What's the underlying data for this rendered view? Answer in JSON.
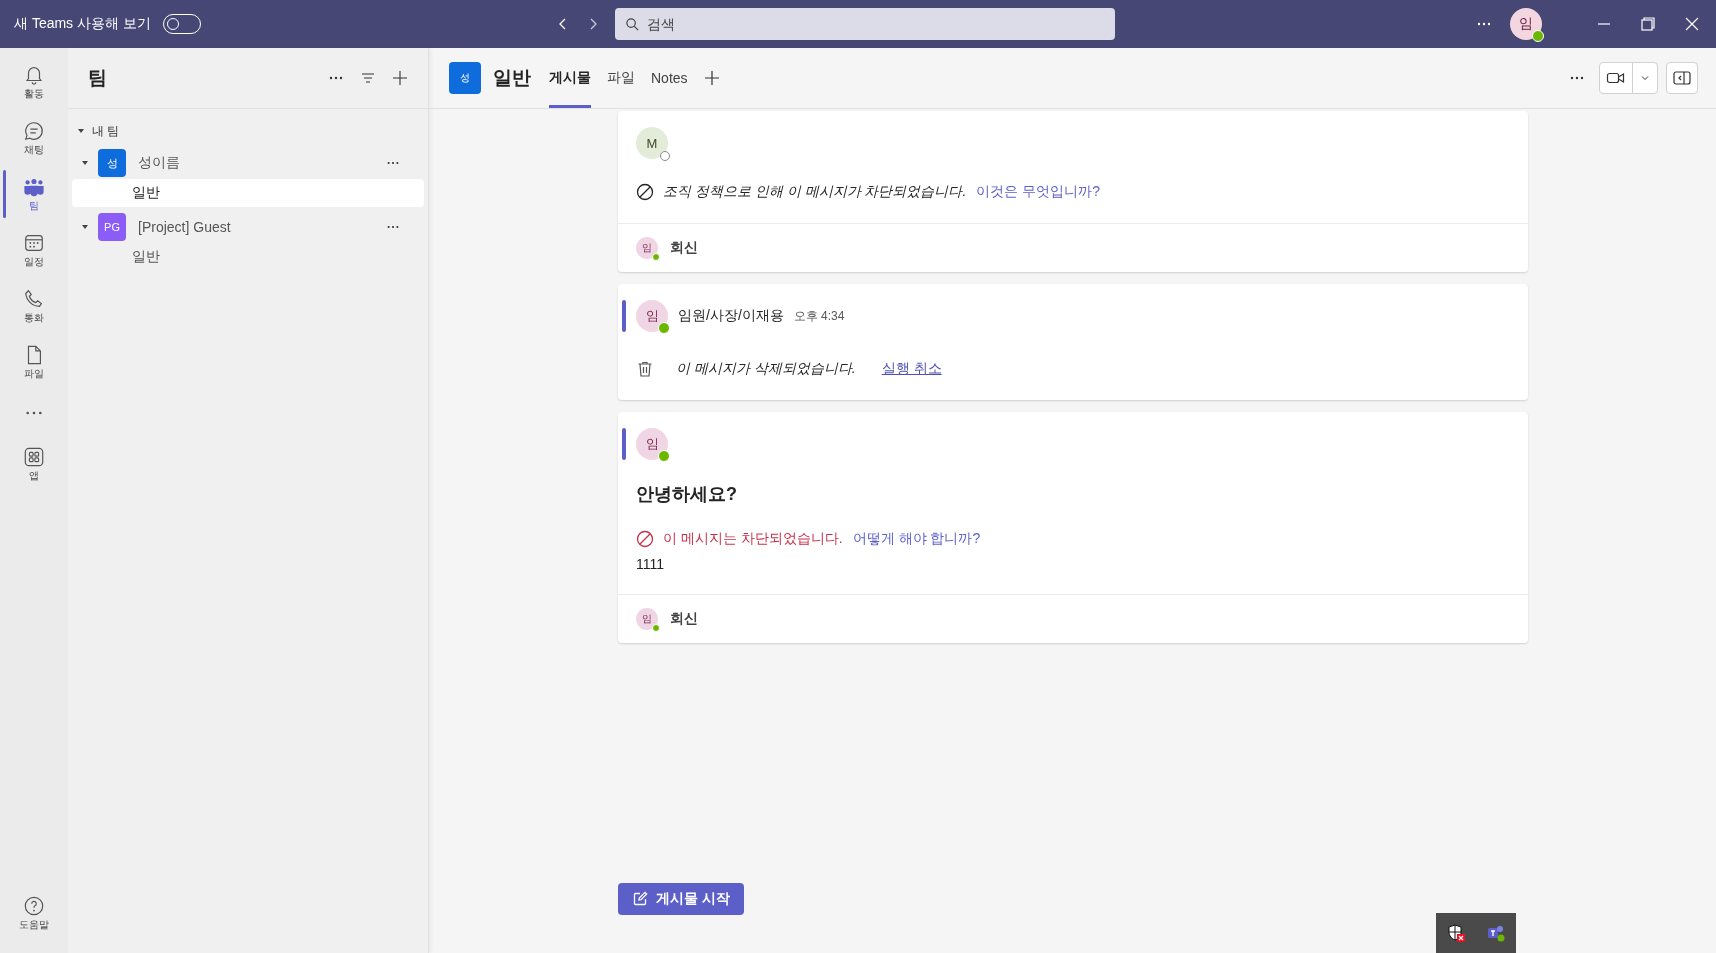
{
  "top_bar": {
    "toggle_label": "새 Teams 사용해 보기",
    "toggle_on": false,
    "search_placeholder": "검색",
    "avatar": "임"
  },
  "rail": {
    "items": [
      {
        "label": "활동",
        "selected": false
      },
      {
        "label": "채팅",
        "selected": false
      },
      {
        "label": "팀",
        "selected": true
      },
      {
        "label": "일정",
        "selected": false
      },
      {
        "label": "통화",
        "selected": false
      },
      {
        "label": "파일",
        "selected": false
      },
      {
        "kind": "more"
      },
      {
        "label": "앱",
        "selected": false
      }
    ],
    "help": "도움말"
  },
  "teams_panel": {
    "title": "팀",
    "section": {
      "label": "내 팀",
      "expanded": true,
      "teams": [
        {
          "avatar": "성",
          "color": "#0f6cdc",
          "name": "성이름",
          "expanded": true,
          "channels": [
            {
              "name": "일반",
              "selected": true
            }
          ]
        },
        {
          "avatar": "PG",
          "color": "#8b5cf6",
          "name": "[Project] Guest",
          "expanded": true,
          "channels": [
            {
              "name": "일반",
              "selected": false
            }
          ]
        }
      ]
    }
  },
  "channel_header": {
    "avatar": "성",
    "name": "일반",
    "tabs": [
      {
        "label": "게시물",
        "selected": true
      },
      {
        "label": "파일",
        "selected": false
      },
      {
        "label": "Notes",
        "selected": false
      }
    ]
  },
  "posts": [
    {
      "kind": "policy_blocked",
      "accent": false,
      "avatar": "M",
      "online": false,
      "notice": "조직 정책으로 인해 이 메시지가 차단되었습니다.",
      "link": "이것은 무엇입니까?",
      "reply": {
        "avatar": "임",
        "label": "회신"
      }
    },
    {
      "kind": "deleted",
      "accent": true,
      "avatar": "임",
      "online": true,
      "author": "임원/사장/이재용",
      "time": "오후 4:34",
      "notice": "이 메시지가 삭제되었습니다.",
      "link": "실행 취소"
    },
    {
      "kind": "blocked",
      "accent": true,
      "avatar": "임",
      "online": true,
      "subject": "안녕하세요?",
      "notice": "이 메시지는 차단되었습니다.",
      "link": "어떻게 해야 합니까?",
      "body": "1111",
      "reply": {
        "avatar": "임",
        "label": "회신"
      }
    }
  ],
  "new_post_button": "게시물 시작"
}
